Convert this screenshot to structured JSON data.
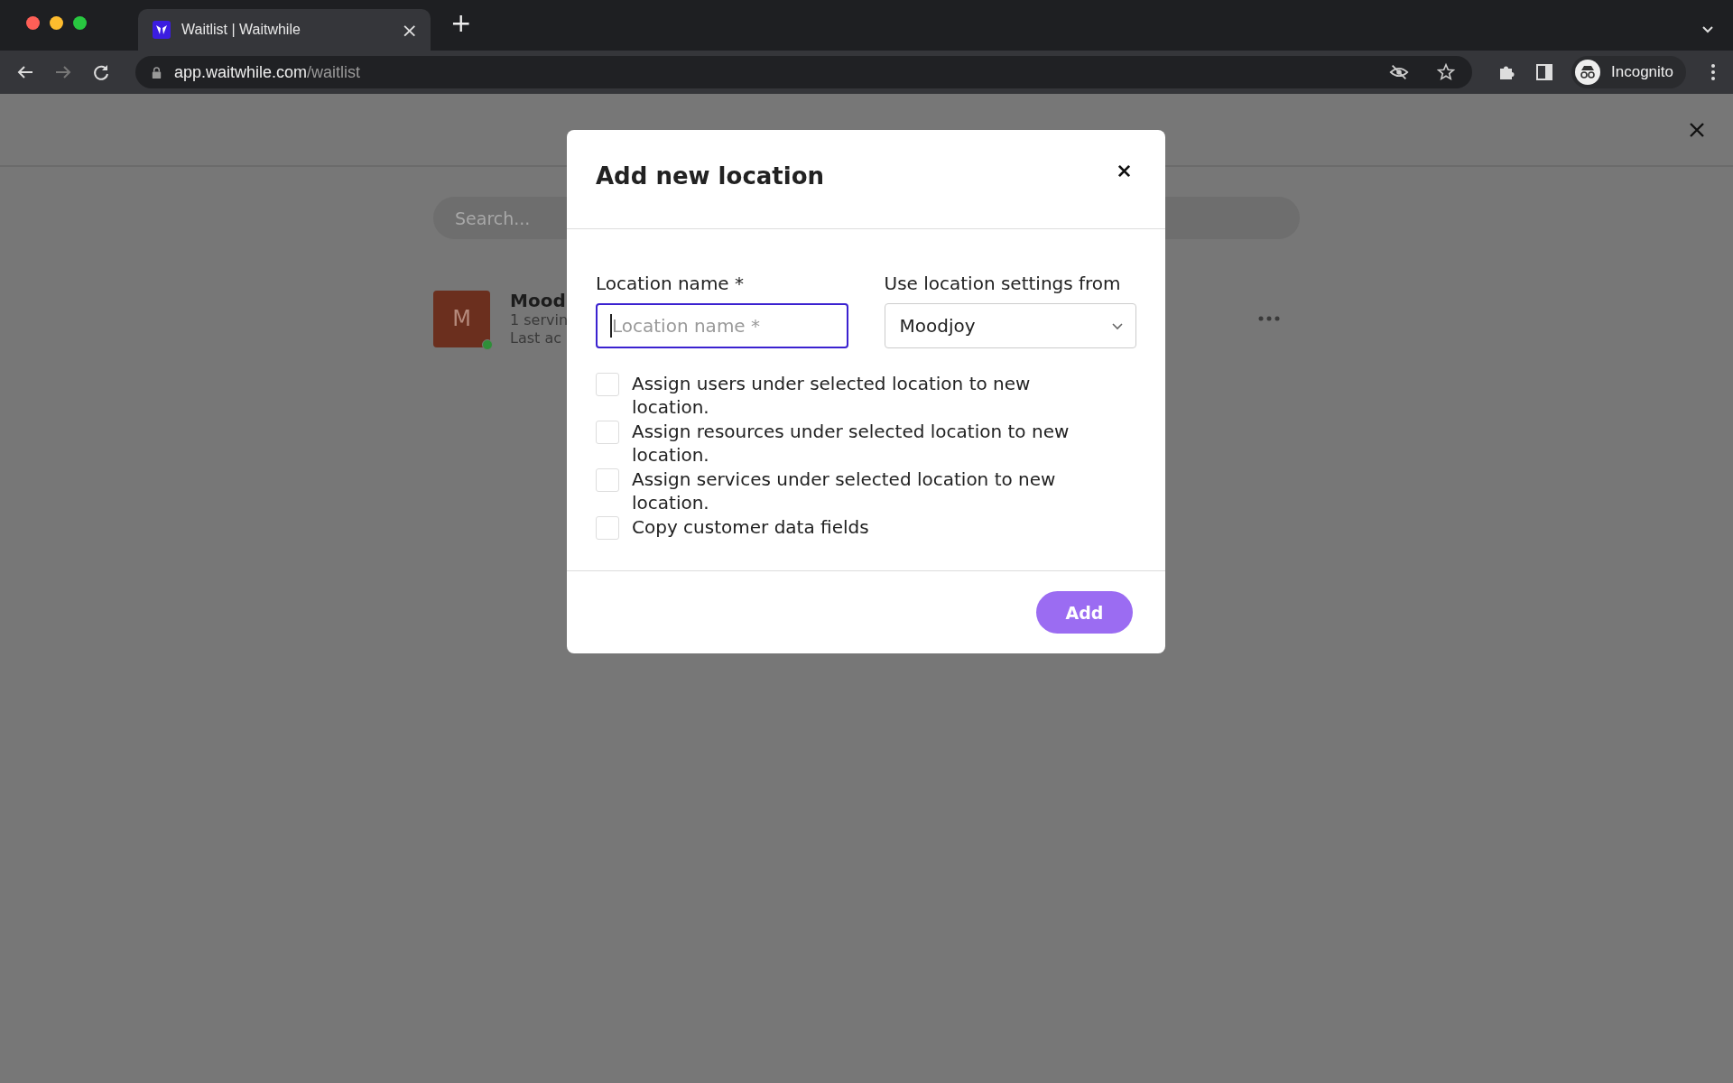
{
  "browser": {
    "tabs": [
      {
        "title": "Waitlist | Waitwhile",
        "close": "×",
        "selected": true
      }
    ],
    "new_tab": "+",
    "url": {
      "host": "app.waitwhile.com",
      "path": "/waitlist"
    },
    "profile": "Incognito"
  },
  "page": {
    "search": {
      "placeholder": "Search..."
    },
    "locations": [
      {
        "initial": "M",
        "name": "Mood",
        "line_1": "1 servin",
        "line_2": "Last ac",
        "online": true
      }
    ]
  },
  "dialog": {
    "title": "Add new location",
    "fields": [
      {
        "kind": "text",
        "label": "Location name *",
        "placeholder": "Location name *",
        "focused": true
      },
      {
        "kind": "select",
        "label": "Use location settings from",
        "value": "Moodjoy"
      }
    ],
    "options": [
      {
        "label": "Assign users under selected location to new location.",
        "checked": false
      },
      {
        "label": "Assign resources under selected location to new location.",
        "checked": false
      },
      {
        "label": "Assign services under selected location to new location.",
        "checked": false
      },
      {
        "label": "Copy customer data fields",
        "checked": false
      }
    ],
    "submit": "Add"
  }
}
